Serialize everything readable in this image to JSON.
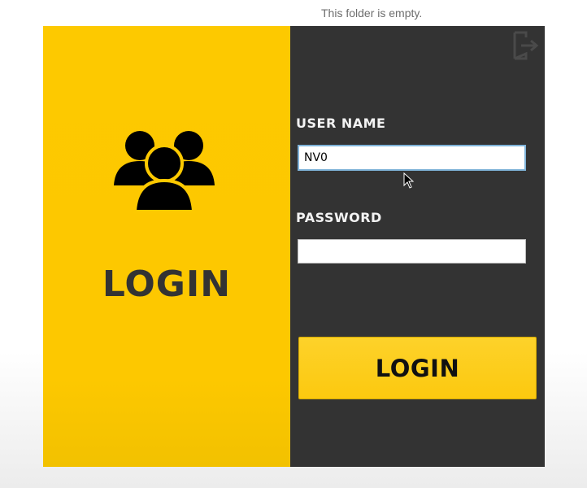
{
  "explorer": {
    "empty_message": "This folder is empty."
  },
  "login_form": {
    "title": "LOGIN",
    "username_label": "USER NAME",
    "username_value": "NV0",
    "password_label": "PASSWORD",
    "password_value": "",
    "submit_label": "LOGIN"
  },
  "icons": {
    "users": "users-group-icon",
    "exit": "exit-door-icon"
  },
  "colors": {
    "accent_yellow": "#fdc900",
    "panel_dark": "#333333",
    "title_text": "#333333"
  }
}
